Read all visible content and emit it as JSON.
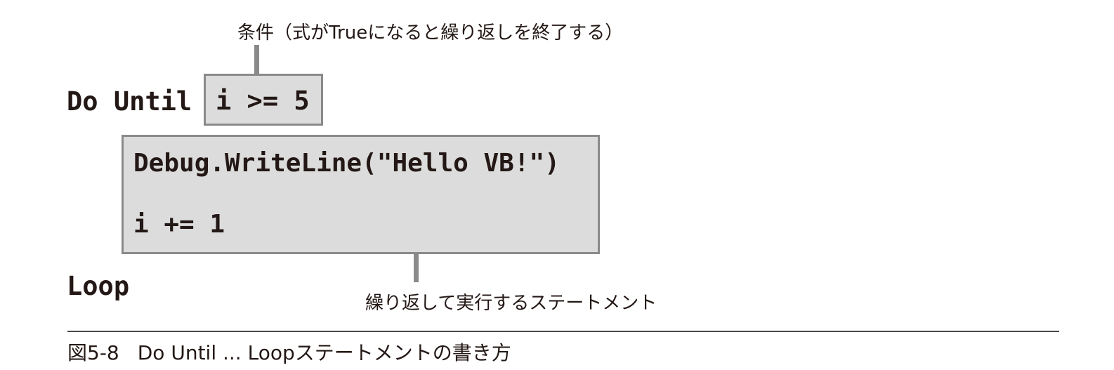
{
  "diagram": {
    "do_until_keyword": "Do Until",
    "condition_code": "i >= 5",
    "statement_line_1": "Debug.WriteLine(\"Hello VB!\")",
    "statement_line_2": "i += 1",
    "loop_keyword": "Loop",
    "condition_annotation": "条件（式がTrueになると繰り返しを終了する）",
    "statements_annotation": "繰り返して実行するステートメント"
  },
  "caption": {
    "figure_number": "図5-8",
    "title": "Do Until ... Loopステートメントの書き方"
  },
  "colors": {
    "box_fill": "#dcdcdc",
    "box_border": "#8a8a8a",
    "text": "#231815"
  }
}
